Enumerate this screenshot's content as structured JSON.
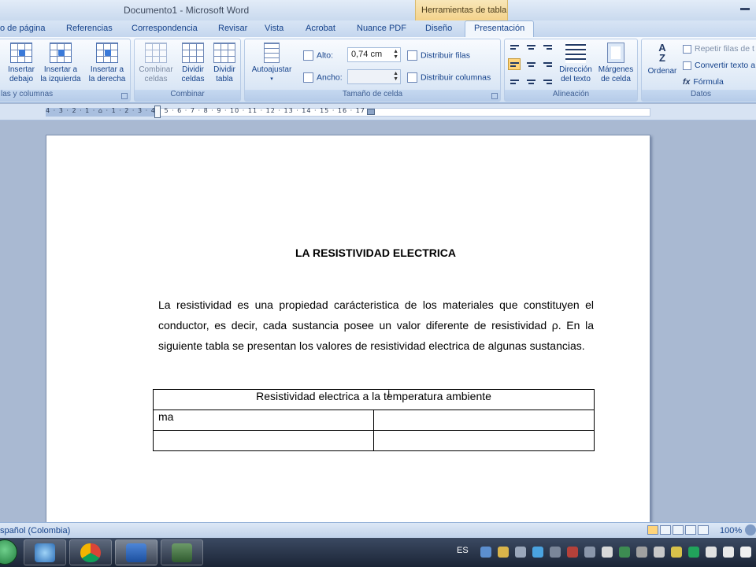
{
  "window": {
    "title": "Documento1 - Microsoft Word",
    "contextual_group": "Herramientas de tabla"
  },
  "tabs": [
    "o de página",
    "Referencias",
    "Correspondencia",
    "Revisar",
    "Vista",
    "Acrobat",
    "Nuance PDF",
    "Diseño",
    "Presentación"
  ],
  "active_tab": "Presentación",
  "ribbon": {
    "rows_columns": {
      "label": "las y columnas",
      "buttons": [
        "Insertar debajo",
        "Insertar a la izquierda",
        "Insertar a la derecha"
      ],
      "btn0_line1": "Insertar",
      "btn0_line2": "debajo",
      "btn1_line1": "Insertar a",
      "btn1_line2": "la izquierda",
      "btn2_line1": "Insertar a",
      "btn2_line2": "la derecha"
    },
    "merge": {
      "label": "Combinar",
      "b0_l1": "Combinar",
      "b0_l2": "celdas",
      "b1_l1": "Dividir",
      "b1_l2": "celdas",
      "b2_l1": "Dividir",
      "b2_l2": "tabla"
    },
    "cell_size": {
      "label": "Tamaño de celda",
      "autofit": "Autoajustar",
      "height_label": "Alto:",
      "height_value": "0,74 cm",
      "width_label": "Ancho:",
      "width_value": "",
      "distribute_rows": "Distribuir filas",
      "distribute_columns": "Distribuir columnas"
    },
    "alignment": {
      "label": "Alineación",
      "direction_l1": "Dirección",
      "direction_l2": "del texto",
      "margins_l1": "Márgenes",
      "margins_l2": "de celda"
    },
    "data": {
      "label": "Datos",
      "sort": "Ordenar",
      "repeat_header": "Repetir filas de t",
      "convert": "Convertir texto a",
      "formula": "Fórmula"
    }
  },
  "ruler": {
    "ticks": "4 · 3 · 2 · 1 · ⌂ · 1 · 2 · 3 · 4 · 5 · 6 · 7 · 8 · 9 · 10 · 11 · 12 · 13 · 14 · 15 · 16 · 17 ·"
  },
  "document": {
    "title": "LA RESISTIVIDAD ELECTRICA",
    "paragraph": "La resistividad es una propiedad carácteristica de los materiales que constituyen el conductor, es decir, cada sustancia posee un valor diferente de resistividad ρ. En la siguiente tabla se presentan los valores de resistividad electrica de algunas sustancias.",
    "table": {
      "header": "Resistividad electrica a la temperatura ambiente",
      "rows": [
        [
          "ma",
          ""
        ],
        [
          "",
          ""
        ]
      ]
    }
  },
  "statusbar": {
    "language": "spañol (Colombia)",
    "zoom": "100%"
  },
  "taskbar": {
    "tray_language": "ES"
  }
}
